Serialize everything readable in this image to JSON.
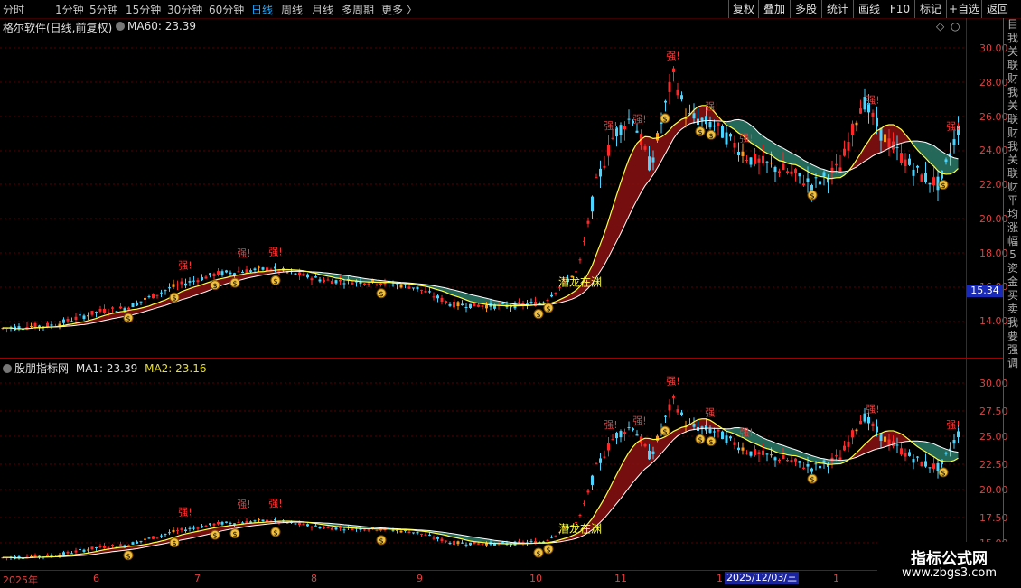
{
  "toolbar": {
    "periods": [
      "分时",
      "1分钟",
      "5分钟",
      "15分钟",
      "30分钟",
      "60分钟",
      "日线",
      "周线",
      "月线",
      "多周期",
      "更多 〉"
    ],
    "active_period": "日线",
    "right_buttons": [
      "复权",
      "叠加",
      "多股",
      "统计",
      "画线",
      "F10",
      "标记",
      "+自选",
      "返回"
    ]
  },
  "upper_panel": {
    "title": "格尔软件(日线,前复权)",
    "ma_label": "MA60: 23.39",
    "diamond": "◇",
    "y_ticks": [
      "30.00",
      "28.00",
      "26.00",
      "24.00",
      "22.00",
      "20.00",
      "18.00",
      "16.00",
      "14.00"
    ],
    "price_tag": "15.34",
    "annotation": "潜龙在渊"
  },
  "lower_panel": {
    "title": "股朋指标网",
    "ma1_label": "MA1: 23.39",
    "ma2_label": "MA2: 23.16",
    "y_ticks": [
      "30.00",
      "27.50",
      "25.00",
      "22.50",
      "20.00",
      "17.50",
      "15.00"
    ],
    "annotation": "潜龙在渊"
  },
  "date_axis": {
    "labels": [
      "2025年",
      "6",
      "7",
      "8",
      "9",
      "10",
      "11",
      "1",
      "1"
    ],
    "cursor": "2025/12/03/三"
  },
  "side_strip": [
    "目",
    "我",
    "关",
    "联",
    "财",
    "我",
    "关",
    "联",
    "财",
    "我",
    "关",
    "联",
    "财",
    "平",
    "均",
    "涨",
    "幅",
    "5",
    "资",
    "金",
    "买",
    "卖",
    "我",
    "要",
    "强",
    "调"
  ],
  "side_strip_lower": [
    "目",
    "我",
    "关",
    "联",
    "财",
    "我",
    "关",
    "联",
    "财"
  ],
  "watermark": {
    "title": "指标公式网",
    "url": "www.zbgs3.com"
  },
  "labels": {
    "strong": "强!",
    "money": "$"
  },
  "colors": {
    "up": "#ff2828",
    "down": "#4ad4ff",
    "ma": "#ffff40",
    "cloud_up": "#8a1010",
    "cloud_down": "#2a7a6a"
  }
}
